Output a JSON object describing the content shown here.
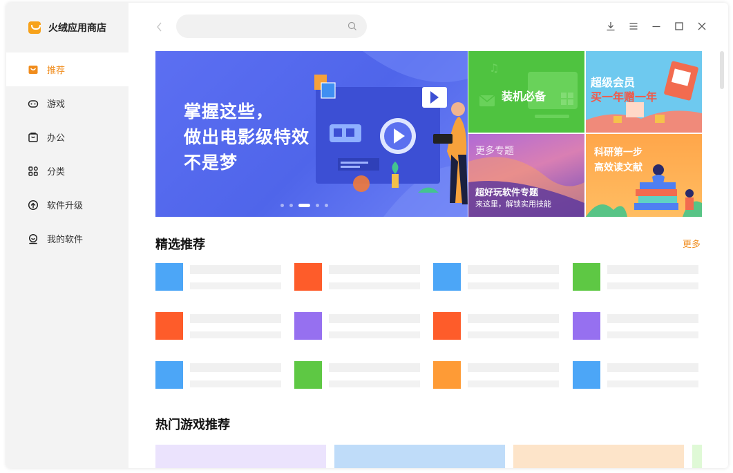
{
  "app": {
    "name": "火绒应用商店"
  },
  "sidebar": {
    "items": [
      {
        "label": "推荐",
        "icon": "recommend-icon",
        "active": true
      },
      {
        "label": "游戏",
        "icon": "gamepad-icon"
      },
      {
        "label": "办公",
        "icon": "briefcase-icon"
      },
      {
        "label": "分类",
        "icon": "grid-icon"
      },
      {
        "label": "软件升级",
        "icon": "upgrade-icon"
      },
      {
        "label": "我的软件",
        "icon": "my-software-icon"
      }
    ]
  },
  "search": {
    "value": "",
    "placeholder": ""
  },
  "banner": {
    "main_lines": [
      "掌握这些，",
      "做出电影级特效",
      "不是梦"
    ],
    "slide_count": 5,
    "active_slide": 3,
    "tiles": {
      "essential": "装机必备",
      "vip_line1": "超级会员",
      "vip_line2": "买一年赠一年",
      "topics_header": "更多专题",
      "topics_title": "超好玩软件专题",
      "topics_sub": "来这里，解锁实用技能",
      "research_line1": "科研第一步",
      "research_line2": "高效读文献"
    }
  },
  "featured": {
    "title": "精选推荐",
    "more": "更多",
    "icon_colors": [
      "#4ca6f7",
      "#fe5c2a",
      "#4ca6f7",
      "#5ec844",
      "#fe5c2a",
      "#9670f0",
      "#fe5c2a",
      "#9670f0",
      "#4ca6f7",
      "#5ec844",
      "#fe9b36",
      "#4ca6f7"
    ]
  },
  "hot_games": {
    "title": "热门游戏推荐",
    "card_colors": [
      "#ebe3fd",
      "#bfdcf9",
      "#fde4c9",
      "#dff9d6"
    ]
  },
  "colors": {
    "accent": "#f08c1c",
    "sidebar_bg": "#f3f3f3"
  }
}
